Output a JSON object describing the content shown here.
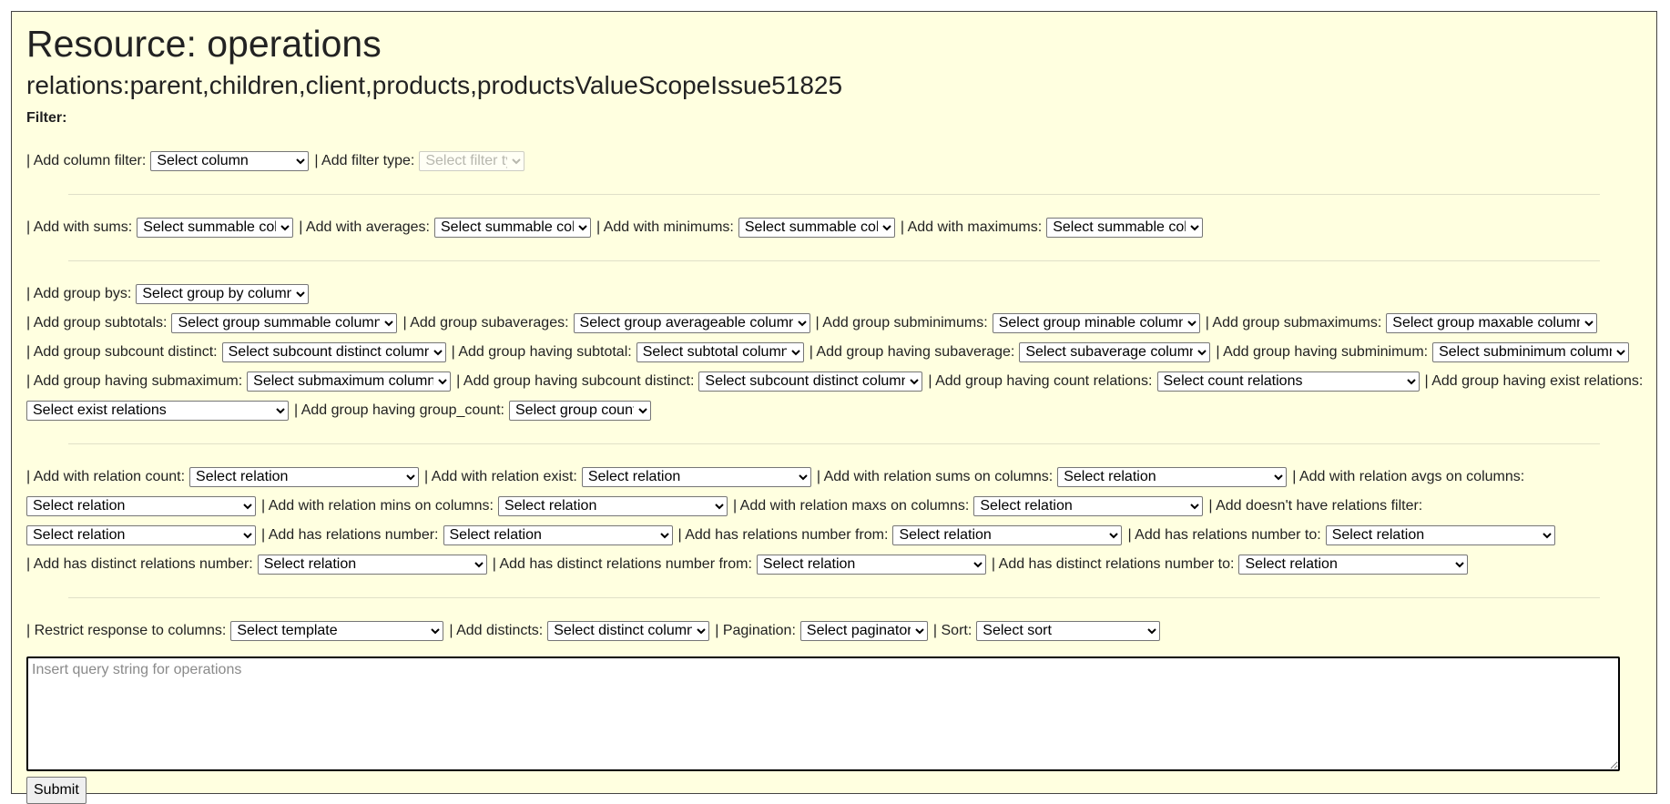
{
  "title": "Resource: operations",
  "relations": "relations:parent,children,client,products,productsValueScopeIssue51825",
  "filter_label": "Filter:",
  "col_filter": {
    "col_label": "| Add column filter:",
    "col_select": "Select column",
    "type_label": "| Add filter type:",
    "type_select": "Select filter type"
  },
  "aggregates": {
    "sums_label": "| Add with sums:",
    "sums_select": "Select summable column",
    "avgs_label": "| Add with averages:",
    "avgs_select": "Select summable column",
    "mins_label": "| Add with minimums:",
    "mins_select": "Select summable column",
    "maxs_label": "| Add with maximums:",
    "maxs_select": "Select summable column"
  },
  "group": {
    "bys_label": "| Add group bys:",
    "bys_select": "Select group by column",
    "subtotals_label": "| Add group subtotals:",
    "subtotals_select": "Select group summable column",
    "subaverages_label": "| Add group subaverages:",
    "subaverages_select": "Select group averageable column",
    "subminimums_label": "| Add group subminimums:",
    "subminimums_select": "Select group minable column",
    "submaximums_label": "| Add group submaximums:",
    "submaximums_select": "Select group maxable column",
    "subcount_distinct_label": "| Add group subcount distinct:",
    "subcount_distinct_select": "Select subcount distinct column",
    "having_subtotal_label": "| Add group having subtotal:",
    "having_subtotal_select": "Select subtotal column",
    "having_subaverage_label": "| Add group having subaverage:",
    "having_subaverage_select": "Select subaverage column",
    "having_subminimum_label": "| Add group having subminimum:",
    "having_subminimum_select": "Select subminimum column",
    "having_submaximum_label": "| Add group having submaximum:",
    "having_submaximum_select": "Select submaximum column",
    "having_subcount_distinct_label": "| Add group having subcount distinct:",
    "having_subcount_distinct_select": "Select subcount distinct column",
    "having_count_relations_label": "| Add group having count relations:",
    "having_count_relations_select": "Select count relations",
    "having_exist_relations_label": "| Add group having exist relations:",
    "having_exist_relations_select": "Select exist relations",
    "having_group_count_label": "| Add group having group_count:",
    "having_group_count_select": "Select group count"
  },
  "relation": {
    "count_label": "| Add with relation count:",
    "count_select": "Select relation",
    "exist_label": "| Add with relation exist:",
    "exist_select": "Select relation",
    "sums_label": "| Add with relation sums on columns:",
    "sums_select": "Select relation",
    "avgs_label": "| Add with relation avgs on columns:",
    "avgs_select": "Select relation",
    "mins_label": "| Add with relation mins on columns:",
    "mins_select": "Select relation",
    "maxs_label": "| Add with relation maxs on columns:",
    "maxs_select": "Select relation",
    "doesnt_have_label": "| Add doesn't have relations filter:",
    "doesnt_have_select": "Select relation",
    "has_number_label": "| Add has relations number:",
    "has_number_select": "Select relation",
    "has_number_from_label": "| Add has relations number from:",
    "has_number_from_select": "Select relation",
    "has_number_to_label": "| Add has relations number to:",
    "has_number_to_select": "Select relation",
    "distinct_number_label": "| Add has distinct relations number:",
    "distinct_number_select": "Select relation",
    "distinct_number_from_label": "| Add has distinct relations number from:",
    "distinct_number_from_select": "Select relation",
    "distinct_number_to_label": "| Add has distinct relations number to:",
    "distinct_number_to_select": "Select relation"
  },
  "response": {
    "restrict_label": "| Restrict response to columns:",
    "restrict_select": "Select template",
    "distincts_label": "| Add distincts:",
    "distincts_select": "Select distinct column",
    "pagination_label": "| Pagination:",
    "pagination_select": "Select paginator",
    "sort_label": "| Sort:",
    "sort_select": "Select sort"
  },
  "query": {
    "placeholder": "Insert query string for operations",
    "submit_label": "Submit"
  }
}
